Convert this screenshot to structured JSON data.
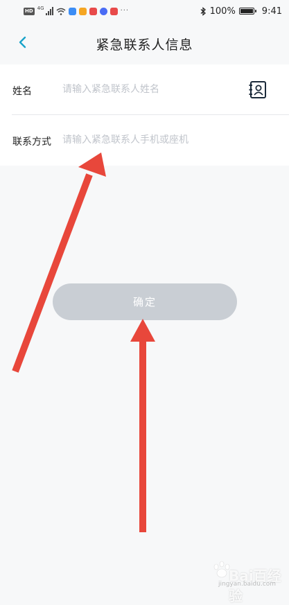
{
  "status_bar": {
    "network_badge": "HD",
    "network_type": "4G",
    "battery_percent": "100%",
    "time": "9:41",
    "more_indicator": "···",
    "app_icons": [
      {
        "name": "app-q-icon",
        "color": "#3c8df5"
      },
      {
        "name": "app-play-icon",
        "color": "#f5a623"
      },
      {
        "name": "app-red-icon",
        "color": "#e84a4a"
      },
      {
        "name": "app-music-icon",
        "color": "#4a6cf5"
      },
      {
        "name": "app-red2-icon",
        "color": "#e84a4a"
      }
    ]
  },
  "nav": {
    "title": "紧急联系人信息",
    "back_icon": "chevron-left-icon",
    "accent": "#1aa3c9"
  },
  "form": {
    "name": {
      "label": "姓名",
      "placeholder": "请输入紧急联系人姓名",
      "icon": "contact-book-icon"
    },
    "contact": {
      "label": "联系方式",
      "placeholder": "请输入紧急联系人手机或座机"
    }
  },
  "confirm_button": {
    "label": "确定",
    "color": "#c9ced4"
  },
  "annotation": {
    "arrow_color": "#e8473b"
  },
  "watermark": {
    "text": "Bai百经验",
    "sub": "jingyan.baidu.com"
  }
}
